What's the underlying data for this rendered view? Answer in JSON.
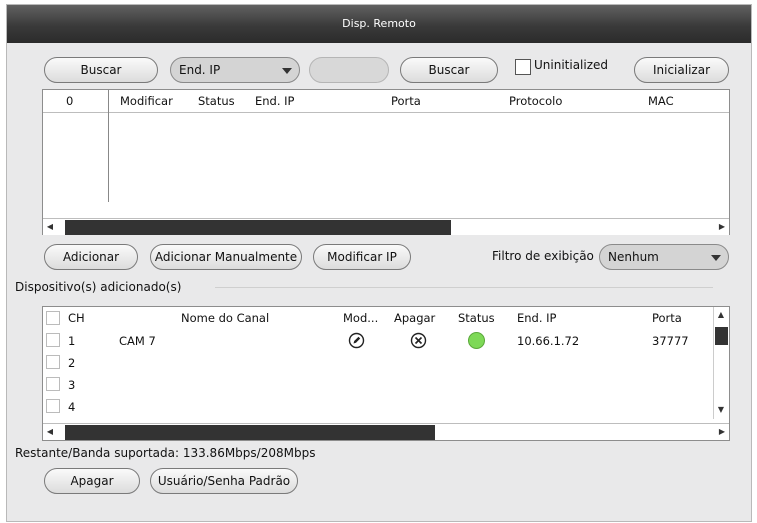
{
  "window": {
    "title": "Disp. Remoto"
  },
  "search_bar": {
    "search_button_1": "Buscar",
    "filter_select_value": "End. IP",
    "search_input_value": "",
    "search_button_2": "Buscar",
    "uninitialized_label": "Uninitialized",
    "initialize_button": "Inicializar"
  },
  "found_table": {
    "columns": [
      "0",
      "Modificar",
      "Status",
      "End. IP",
      "Porta",
      "Protocolo",
      "MAC"
    ]
  },
  "found_actions": {
    "add_button": "Adicionar",
    "add_manual_button": "Adicionar Manualmente",
    "modify_ip_button": "Modificar IP",
    "display_filter_label": "Filtro de exibição",
    "display_filter_value": "Nenhum"
  },
  "added_section": {
    "title": "Dispositivo(s) adicionado(s)",
    "columns": [
      "CH",
      "Nome do Canal",
      "Mod...",
      "Apagar",
      "Status",
      "End. IP",
      "Porta"
    ],
    "rows": [
      {
        "ch": "1",
        "name": "CAM 7",
        "ip": "10.66.1.72",
        "port": "37777",
        "status_color": "#7ed957"
      },
      {
        "ch": "2",
        "name": "",
        "ip": "",
        "port": ""
      },
      {
        "ch": "3",
        "name": "",
        "ip": "",
        "port": ""
      },
      {
        "ch": "4",
        "name": "",
        "ip": "",
        "port": ""
      }
    ]
  },
  "footer": {
    "bandwidth_text": "Restante/Banda suportada: 133.86Mbps/208Mbps",
    "delete_button": "Apagar",
    "default_user_button": "Usuário/Senha Padrão"
  }
}
